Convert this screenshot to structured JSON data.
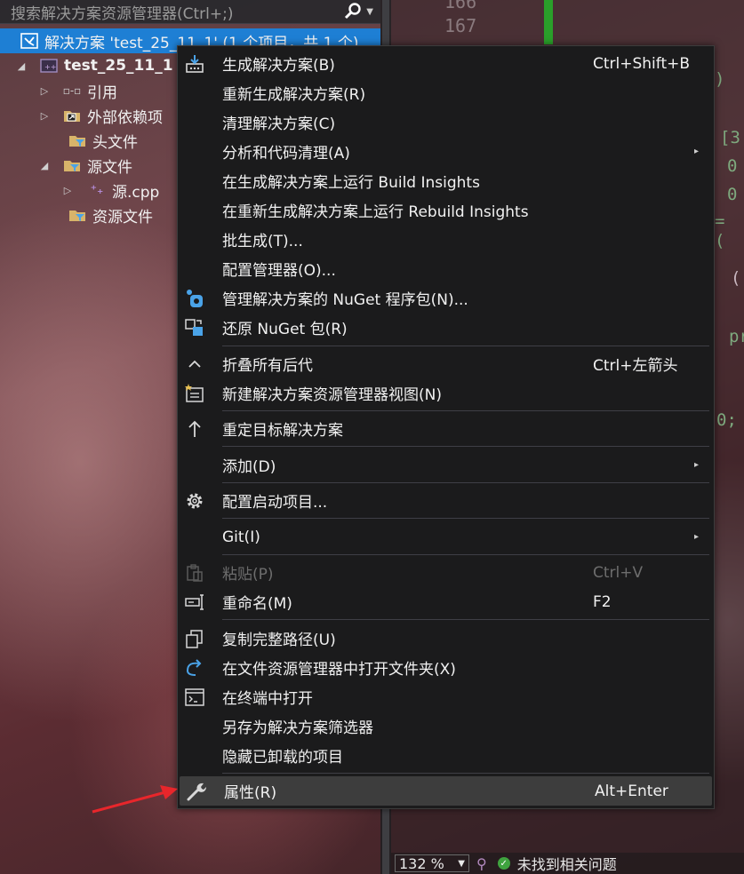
{
  "search": {
    "placeholder": "搜索解决方案资源管理器(Ctrl+;)"
  },
  "tree": {
    "solution": "解决方案 'test_25_11_1' (1 个项目，共 1 个)",
    "project": "test_25_11_1",
    "items": [
      {
        "label": "引用"
      },
      {
        "label": "外部依赖项"
      },
      {
        "label": "头文件"
      },
      {
        "label": "源文件"
      },
      {
        "label": "源.cpp"
      },
      {
        "label": "资源文件"
      }
    ]
  },
  "editor": {
    "line_numbers": [
      "166",
      "167"
    ],
    "code_fragments": [
      ")",
      "[3",
      "0",
      "0",
      "= (",
      "(.",
      "pr",
      "0;"
    ]
  },
  "status": {
    "zoom": "132 %",
    "issues": "未找到相关问题"
  },
  "menu": {
    "items": [
      {
        "label": "生成解决方案(B)",
        "shortcut": "Ctrl+Shift+B",
        "icon": "build-icon"
      },
      {
        "label": "重新生成解决方案(R)"
      },
      {
        "label": "清理解决方案(C)"
      },
      {
        "label": "分析和代码清理(A)",
        "submenu": true
      },
      {
        "label": "在生成解决方案上运行 Build Insights"
      },
      {
        "label": "在重新生成解决方案上运行 Rebuild Insights"
      },
      {
        "label": "批生成(T)..."
      },
      {
        "label": "配置管理器(O)..."
      },
      {
        "label": "管理解决方案的 NuGet 程序包(N)...",
        "icon": "nuget-icon"
      },
      {
        "label": "还原 NuGet 包(R)",
        "icon": "restore-packages-icon"
      },
      {
        "label": "折叠所有后代",
        "shortcut": "Ctrl+左箭头",
        "icon": "collapse-icon"
      },
      {
        "label": "新建解决方案资源管理器视图(N)",
        "icon": "new-view-icon"
      },
      {
        "label": "重定目标解决方案",
        "icon": "retarget-icon"
      },
      {
        "label": "添加(D)",
        "submenu": true
      },
      {
        "label": "配置启动项目...",
        "icon": "gear-icon"
      },
      {
        "label": "Git(I)",
        "submenu": true
      },
      {
        "label": "粘贴(P)",
        "shortcut": "Ctrl+V",
        "icon": "paste-icon",
        "disabled": true
      },
      {
        "label": "重命名(M)",
        "shortcut": "F2",
        "icon": "rename-icon"
      },
      {
        "label": "复制完整路径(U)",
        "icon": "copy-icon"
      },
      {
        "label": "在文件资源管理器中打开文件夹(X)",
        "icon": "open-folder-icon"
      },
      {
        "label": "在终端中打开",
        "icon": "terminal-icon"
      },
      {
        "label": "另存为解决方案筛选器"
      },
      {
        "label": "隐藏已卸载的项目"
      },
      {
        "label": "属性(R)",
        "shortcut": "Alt+Enter",
        "icon": "wrench-icon",
        "highlighted": true
      }
    ],
    "submenu_arrow": "▸"
  },
  "colors": {
    "selection": "#1e7fd4",
    "menu_bg": "#1b1b1c",
    "highlight": "#3d3d3d",
    "annotation": "#e8262b"
  }
}
